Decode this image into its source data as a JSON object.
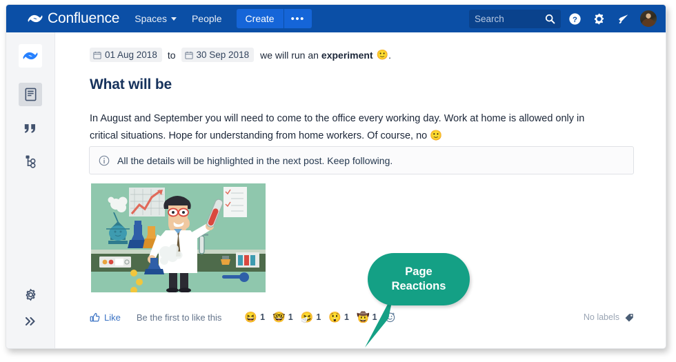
{
  "topnav": {
    "product_name": "Confluence",
    "logo_icon": "confluence-logo-icon",
    "spaces_label": "Spaces",
    "people_label": "People",
    "create_label": "Create",
    "more_label": "•••",
    "search_placeholder": "Search",
    "search_value": "",
    "search_icon": "search-icon",
    "help_icon": "help-circle-icon",
    "settings_icon": "gear-icon",
    "notifications_icon": "megaphone-icon",
    "avatar_icon": "user-avatar",
    "bg_color": "#0b4fa6",
    "create_button_color": "#1565d8"
  },
  "sidebar": {
    "items": [
      {
        "name": "confluence-logo",
        "icon": "confluence-logo-icon",
        "selected": false
      },
      {
        "name": "pages",
        "icon": "page-document-icon",
        "selected": true
      },
      {
        "name": "blog",
        "icon": "blockquote-icon",
        "selected": false
      },
      {
        "name": "space-tree",
        "icon": "sitemap-tree-icon",
        "selected": false
      }
    ],
    "bottom_items": [
      {
        "name": "space-settings",
        "icon": "gear-icon"
      },
      {
        "name": "expand-sidebar",
        "icon": "double-chevron-right-icon"
      }
    ],
    "bg_color": "#f4f5f7"
  },
  "content": {
    "date_line": {
      "start_date": "01 Aug 2018",
      "separator": "to",
      "end_date": "30 Sep 2018",
      "text_before_bold": "we will run an",
      "bold_word": "experiment",
      "emoji": "🙂",
      "trailing": ".",
      "calendar_icon": "calendar-icon"
    },
    "heading": "What will be",
    "paragraph_line1": "In August and September you will need to come to the office every working day. Work at home is allowed only in critical",
    "paragraph_line2": "situations. Hope for understanding from home workers. Of course, no",
    "paragraph_emoji": "🙂",
    "info_panel": {
      "icon": "info-circle-icon",
      "text": "All the details will be highlighted in the next post. Keep following."
    },
    "illustration": {
      "name": "scientist-laboratory-illustration",
      "alt": "Cartoon scientist in a laboratory holding a test tube and a flask"
    }
  },
  "footer": {
    "like_icon": "thumbs-up-icon",
    "like_label": "Like",
    "like_status": "Be the first to like this",
    "reactions": [
      {
        "name": "grinning-squinting-face",
        "emoji": "😆",
        "count": "1"
      },
      {
        "name": "nerd-face",
        "emoji": "🤓",
        "count": "1"
      },
      {
        "name": "sneezing-face",
        "emoji": "🤧",
        "count": "1"
      },
      {
        "name": "astonished-face",
        "emoji": "😲",
        "count": "1"
      },
      {
        "name": "cowboy-hat-face",
        "emoji": "🤠",
        "count": "1"
      }
    ],
    "add_reaction_icon": "add-reaction-icon",
    "labels_text": "No labels",
    "labels_icon": "tag-icon"
  },
  "callout": {
    "line1": "Page",
    "line2": "Reactions",
    "color": "#14a085"
  }
}
